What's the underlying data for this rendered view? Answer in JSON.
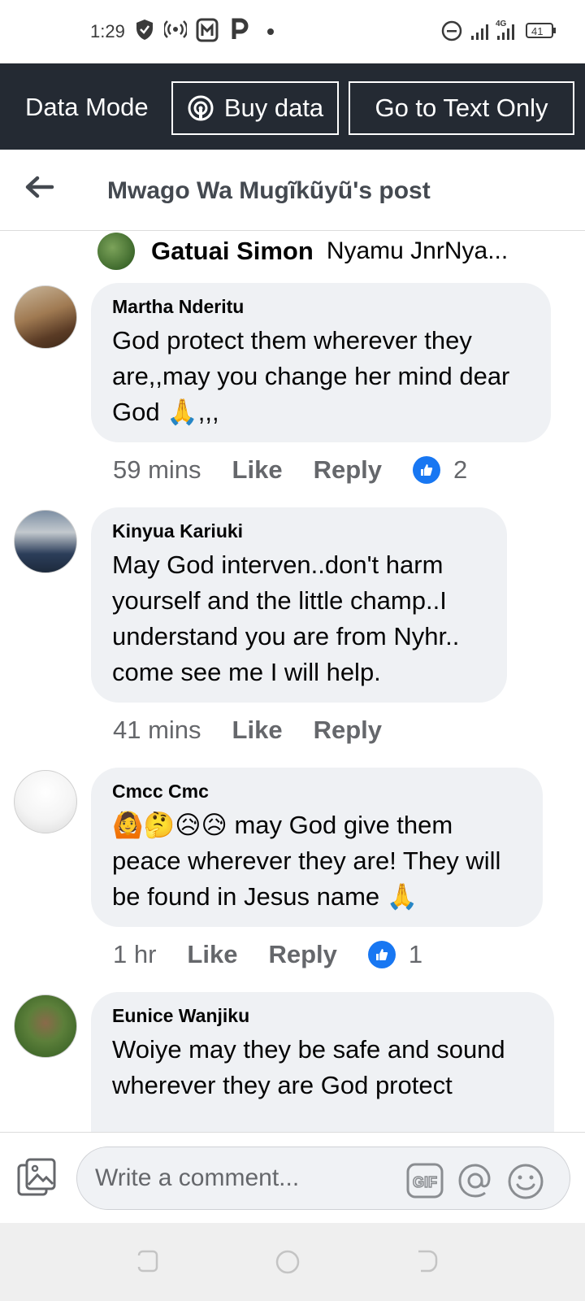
{
  "status_bar": {
    "time": "1:29",
    "battery": "41",
    "network": "4G"
  },
  "data_bar": {
    "mode_label": "Data Mode",
    "buy_label": "Buy data",
    "text_only_label": "Go to Text Only"
  },
  "header": {
    "title": "Mwago Wa Mugĩkũyũ's post"
  },
  "reply_preview": {
    "author": "Gatuai Simon",
    "text": "Nyamu JnrNya..."
  },
  "comments": [
    {
      "author": "Martha Nderitu",
      "text": "God protect them wherever they are,,may you change her mind dear God 🙏,,,",
      "time": "59 mins",
      "like_label": "Like",
      "reply_label": "Reply",
      "likes": "2"
    },
    {
      "author": "Kinyua Kariuki",
      "text": "May God interven..don't harm yourself and the little champ..I understand you are from Nyhr.. come see me I will help.",
      "time": "41 mins",
      "like_label": "Like",
      "reply_label": "Reply"
    },
    {
      "author": "Cmcc Cmc",
      "text": "🙆🤔😥😥 may God give them peace wherever they are! They will be found in Jesus name 🙏",
      "time": "1 hr",
      "like_label": "Like",
      "reply_label": "Reply",
      "likes": "1"
    },
    {
      "author": "Eunice Wanjiku",
      "text": "Woiye may they be safe and sound wherever they are  God protect"
    }
  ],
  "composer": {
    "placeholder": "Write a comment..."
  },
  "colors": {
    "data_bar_bg": "#242a33",
    "bubble_bg": "#eff1f4",
    "like_blue": "#1877f2",
    "meta_gray": "#65676b"
  },
  "icons": [
    "shield-icon",
    "hotspot-icon",
    "app-icon",
    "parking-icon",
    "dnd-icon",
    "signal-icon",
    "battery-icon",
    "broadcast-icon",
    "back-arrow-icon",
    "like-icon",
    "photo-icon",
    "gif-icon",
    "mention-icon",
    "emoji-icon"
  ]
}
